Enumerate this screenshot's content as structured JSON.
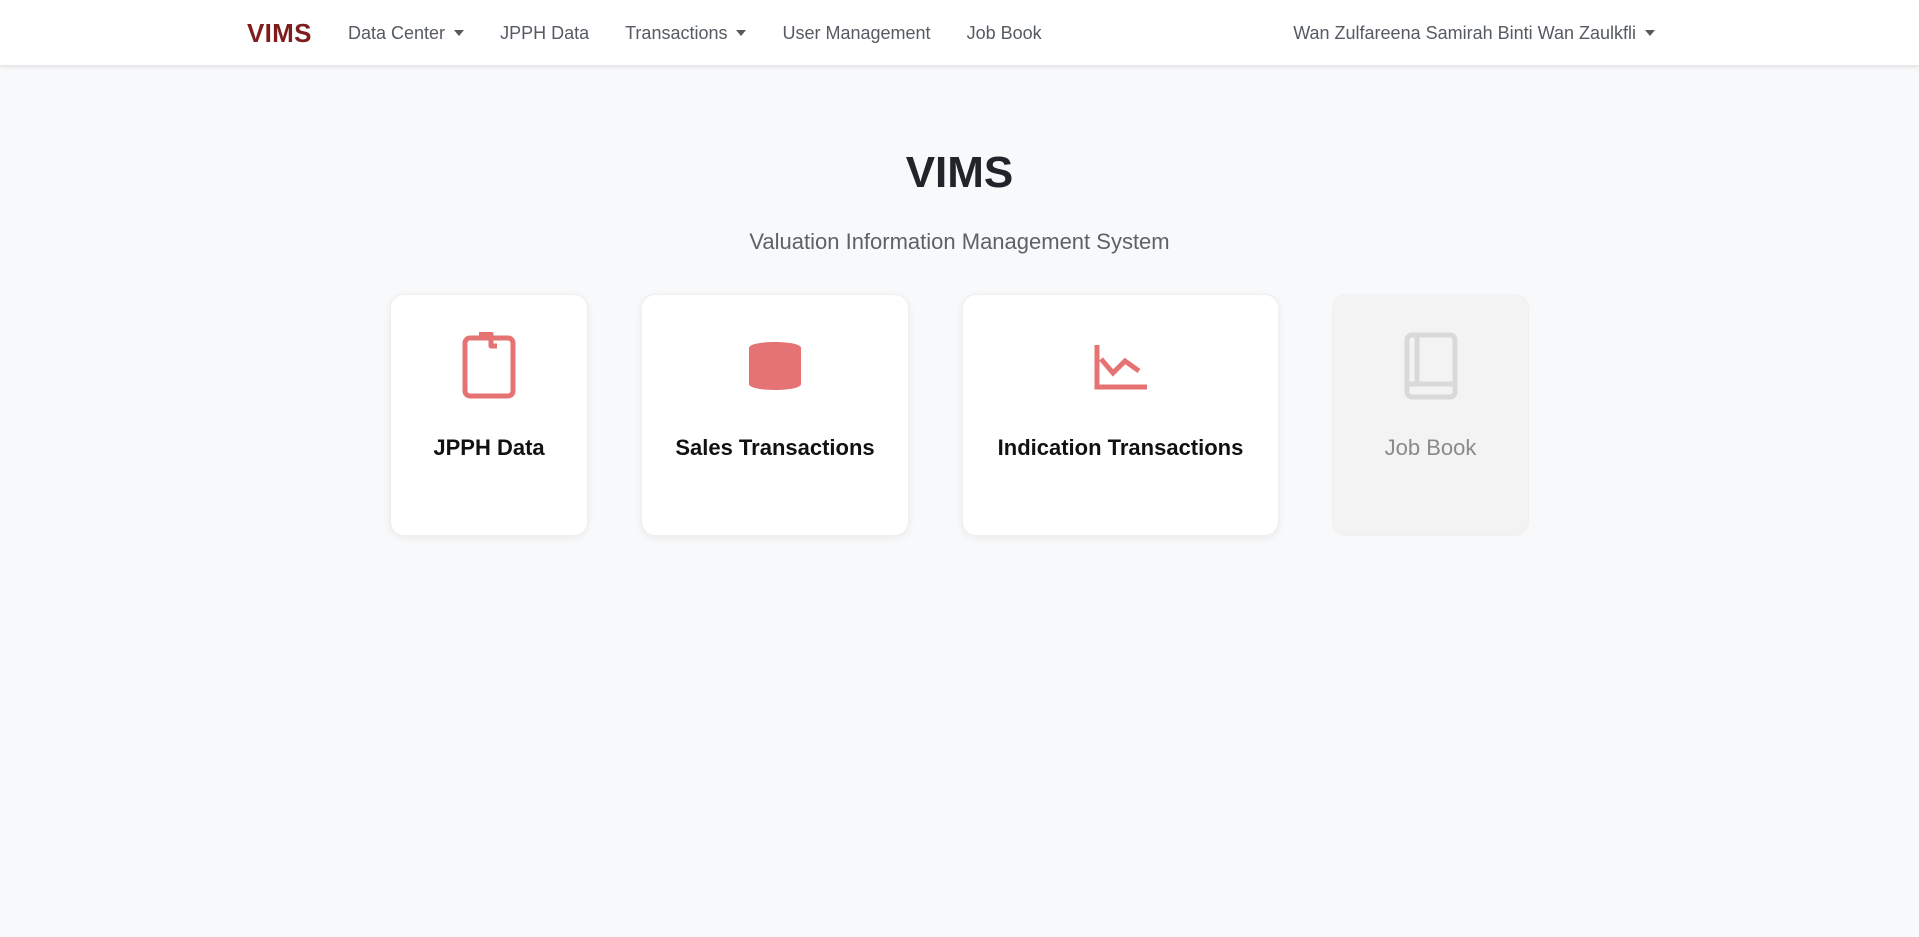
{
  "navbar": {
    "brand": "VIMS",
    "links": [
      {
        "label": "Data Center",
        "dropdown": true
      },
      {
        "label": "JPPH Data",
        "dropdown": false
      },
      {
        "label": "Transactions",
        "dropdown": true
      },
      {
        "label": "User Management",
        "dropdown": false
      },
      {
        "label": "Job Book",
        "dropdown": false
      }
    ],
    "user": "Wan Zulfareena Samirah Binti Wan Zaulkfli"
  },
  "hero": {
    "title": "VIMS",
    "subtitle": "Valuation Information Management System"
  },
  "cards": [
    {
      "label": "JPPH Data",
      "icon": "clipboard-icon",
      "disabled": false
    },
    {
      "label": "Sales Transactions",
      "icon": "database-icon",
      "disabled": false
    },
    {
      "label": "Indication Transactions",
      "icon": "chart-line-icon",
      "disabled": false
    },
    {
      "label": "Job Book",
      "icon": "book-icon",
      "disabled": true
    }
  ],
  "colors": {
    "brand": "#7d1d1d",
    "icon_active": "#e57373",
    "icon_disabled": "#d9d9d9",
    "background": "#f8f9fa"
  }
}
